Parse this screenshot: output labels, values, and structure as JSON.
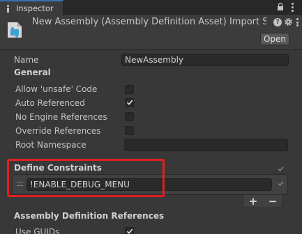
{
  "tab": {
    "label": "Inspector"
  },
  "header": {
    "title": "New Assembly (Assembly Definition Asset) Import Se",
    "open_button": "Open"
  },
  "name_row": {
    "label": "Name",
    "value": "NewAssembly"
  },
  "general": {
    "heading": "General",
    "options": [
      {
        "label": "Allow 'unsafe' Code",
        "checked": false
      },
      {
        "label": "Auto Referenced",
        "checked": true
      },
      {
        "label": "No Engine References",
        "checked": false
      },
      {
        "label": "Override References",
        "checked": false
      }
    ],
    "root_namespace": {
      "label": "Root Namespace",
      "value": ""
    }
  },
  "define_constraints": {
    "heading": "Define Constraints",
    "items": [
      "!ENABLE_DEBUG_MENU"
    ],
    "add_label": "+",
    "remove_label": "−"
  },
  "references": {
    "heading": "Assembly Definition References",
    "use_guids": {
      "label": "Use GUIDs",
      "checked": true
    }
  },
  "colors": {
    "highlight_border": "#e11f1f",
    "tab_accent": "#3a72b0",
    "asset_icon": "#3f9fd6"
  }
}
